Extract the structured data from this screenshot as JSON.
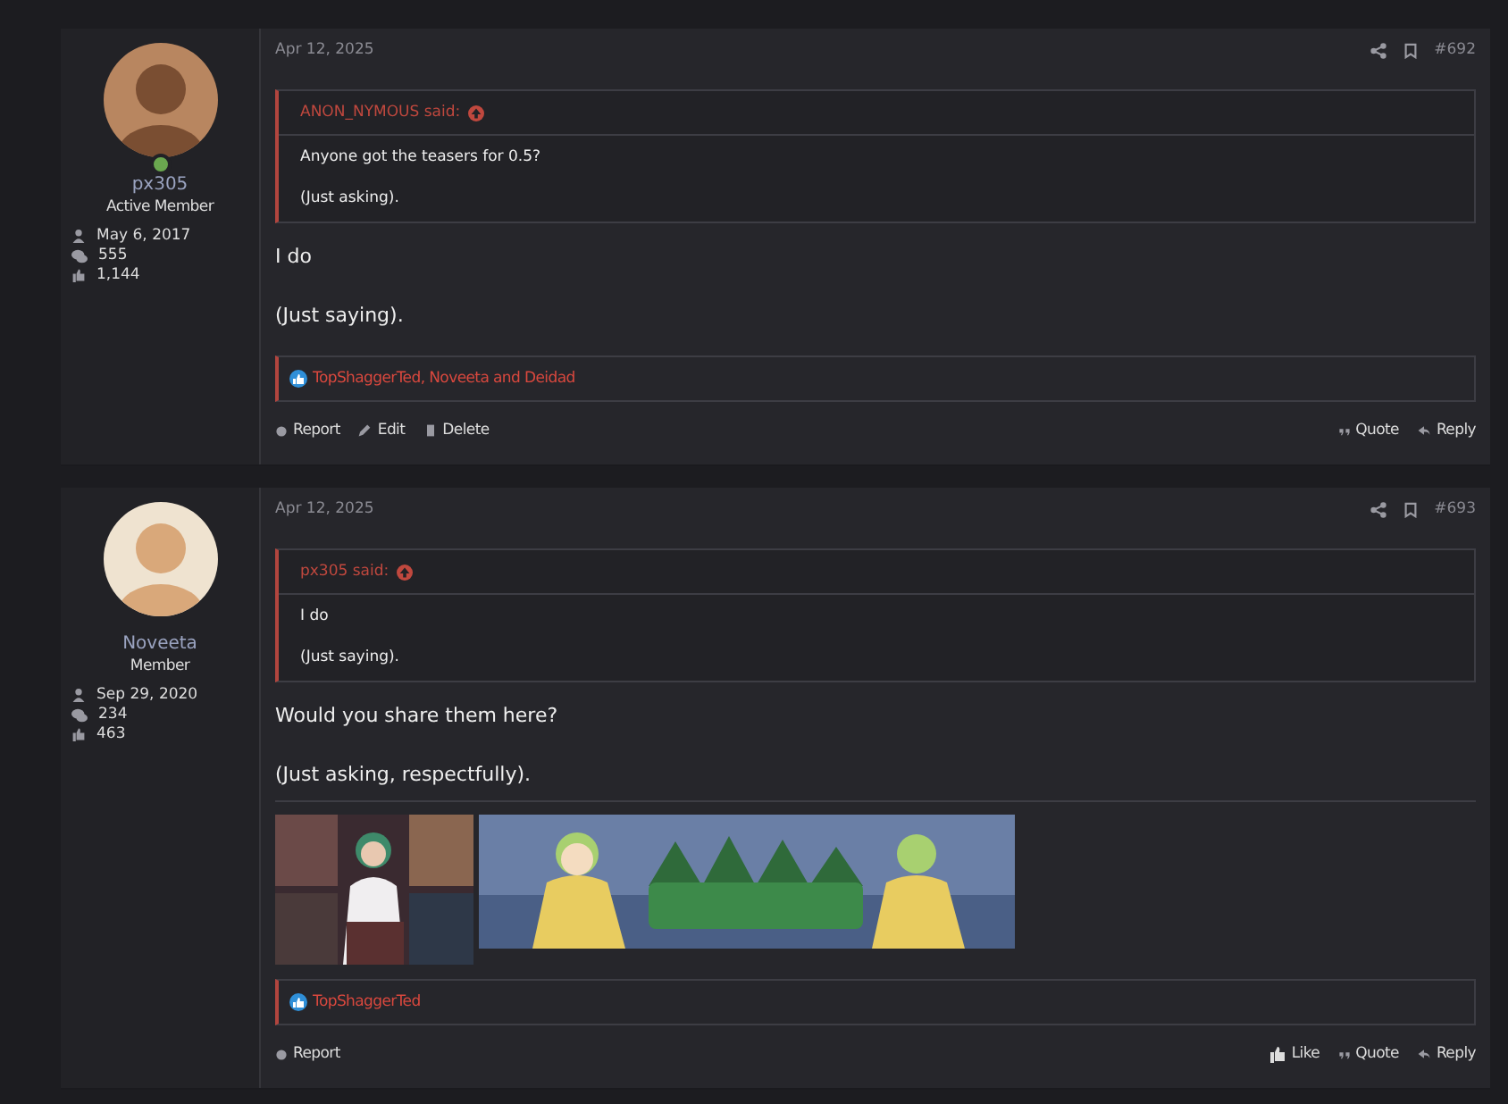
{
  "posts": [
    {
      "author": "px305",
      "role": "Active Member",
      "online": true,
      "joined": "May 6, 2017",
      "messages": "555",
      "reaction_score": "1,144",
      "date": "Apr 12, 2025",
      "number": "#692",
      "quote": {
        "author": "ANON_NYMOUS said:",
        "lines": [
          "Anyone got the teasers for 0.5?",
          "(Just asking)."
        ]
      },
      "body": [
        "I do",
        "(Just saying)."
      ],
      "reactions": "TopShaggerTed, Noveeta and Deidad",
      "actions_left": [
        {
          "kind": "report",
          "label": "Report"
        },
        {
          "kind": "edit",
          "label": "Edit"
        },
        {
          "kind": "delete",
          "label": "Delete"
        }
      ],
      "actions_right": [
        {
          "kind": "quote",
          "label": "Quote"
        },
        {
          "kind": "reply",
          "label": "Reply"
        }
      ]
    },
    {
      "author": "Noveeta",
      "role": "Member",
      "online": false,
      "joined": "Sep 29, 2020",
      "messages": "234",
      "reaction_score": "463",
      "date": "Apr 12, 2025",
      "number": "#693",
      "quote": {
        "author": "px305 said:",
        "lines": [
          "I do",
          "(Just saying)."
        ]
      },
      "body": [
        "Would you share them here?",
        "(Just asking, respectfully)."
      ],
      "signature": [
        {
          "kind": "picture"
        },
        {
          "kind": "picture"
        }
      ],
      "reactions": "TopShaggerTed",
      "actions_left": [
        {
          "kind": "report",
          "label": "Report"
        }
      ],
      "actions_right": [
        {
          "kind": "like",
          "label": "Like"
        },
        {
          "kind": "quote",
          "label": "Quote"
        },
        {
          "kind": "reply",
          "label": "Reply"
        }
      ]
    }
  ]
}
